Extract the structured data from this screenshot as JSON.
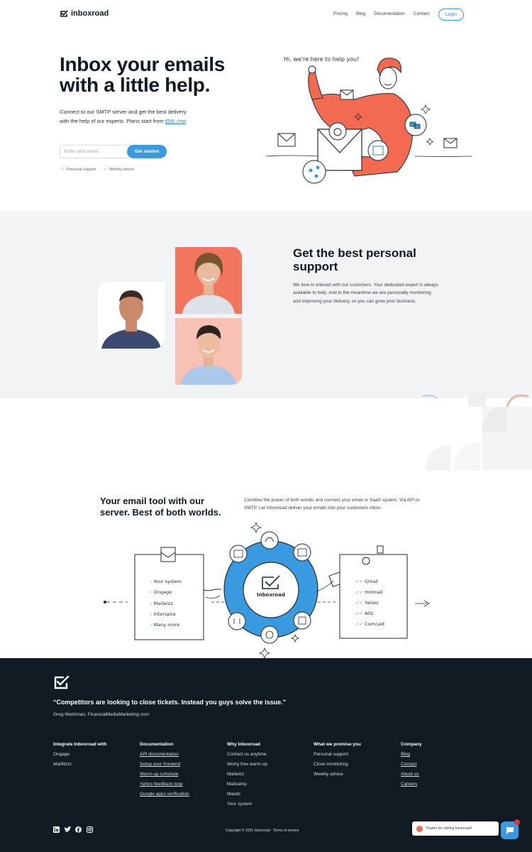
{
  "header": {
    "brand": "inboxroad",
    "nav": [
      "Pricing",
      "Blog",
      "Documentation",
      "Contact"
    ],
    "login": "Login"
  },
  "hero": {
    "title": "Inbox your emails with a little help.",
    "description": "Connect to our SMTP server and get the best delivery with the help of our experts. Plans start from ",
    "price": "€59,-/mo",
    "email_placeholder": "Enter your email",
    "cta": "Get started",
    "perks": [
      "Personal support",
      "Weekly advice"
    ],
    "illustration_caption": "Hi, we're here to help you!"
  },
  "support": {
    "title": "Get the best personal support",
    "text": "We love to interact with our customers. Your dedicated expert is always available to help. And in the meantime we are personally monitoring and improving your delivery, so you can grow your business."
  },
  "tool": {
    "title": "Your email tool with our server. Best of both worlds.",
    "text": "Combine the power of both worlds and connect your email or SaaS system. Via API or SMTP. Let Inboxroad deliver your emails into your customers inbox.",
    "center_label": "Inboxroad",
    "left_items": [
      "Your system",
      "Ongage",
      "Mailwizz",
      "Interspire",
      "Many more"
    ],
    "right_items": [
      "Gmail",
      "Hotmail",
      "Yahoo",
      "AOL",
      "Comcast"
    ]
  },
  "footer": {
    "quote": "“Competitors are looking to close tickets. Instead you guys solve the issue.”",
    "author": "Greg Weitzman, FinancialMediaMarketing.com",
    "columns": [
      {
        "title": "Integrate Inboxroad with",
        "links": [
          "Ongage",
          "MailWizz"
        ]
      },
      {
        "title": "Documentation",
        "links": [
          "API documentation",
          "Setup your frontend",
          "Warm-up schedule",
          "Yahoo feedback loop",
          "Google apps verification"
        ]
      },
      {
        "title": "Why Inboxroad",
        "links": [
          "Contact us anytime",
          "Worry free warm up",
          "Mailwizz",
          "Mailcamp",
          "Mautic",
          "Your system"
        ]
      },
      {
        "title": "What we promise you",
        "links": [
          "Personal support",
          "Close monitoring",
          "Weekly advice"
        ]
      },
      {
        "title": "Company",
        "links": [
          "Blog",
          "Contact",
          "About us",
          "Careers"
        ]
      }
    ],
    "copyright": "Copyright © 2021 Inboxroad · Terms of service",
    "social_icons": [
      "linkedin-icon",
      "twitter-icon",
      "facebook-icon",
      "instagram-icon"
    ],
    "chat_text": "Thanks for visiting Inboxroad!"
  },
  "colors": {
    "accent": "#3a9ae0",
    "orange": "#f26a4f",
    "dark": "#0f1a22",
    "section_bg": "#f2f3f5"
  }
}
